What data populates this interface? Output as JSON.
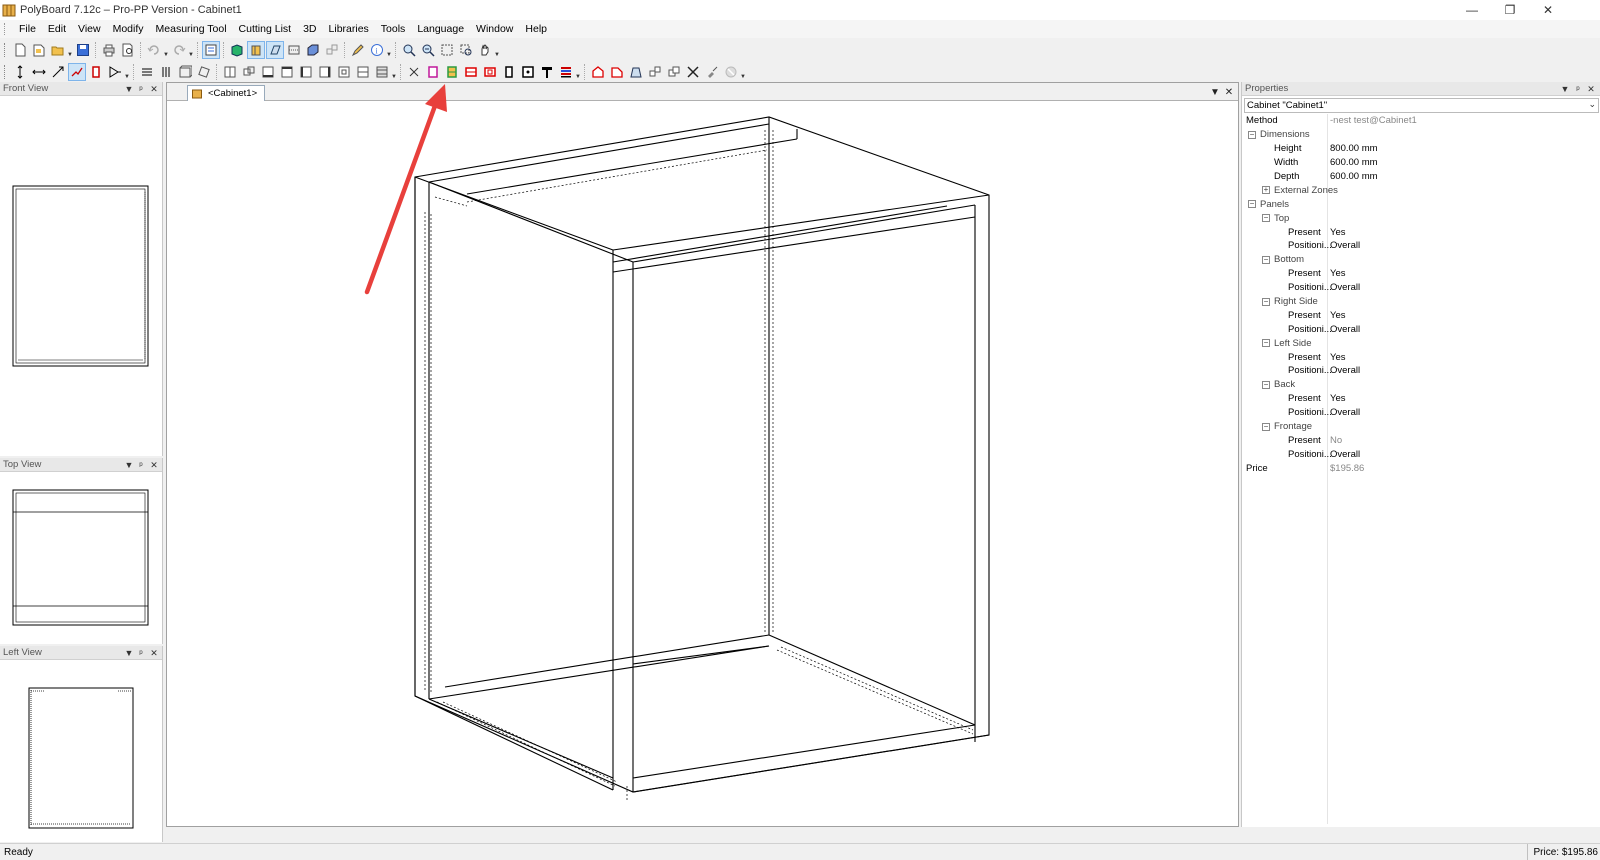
{
  "window": {
    "title": "PolyBoard 7.12c – Pro-PP Version - Cabinet1"
  },
  "menu": [
    "File",
    "Edit",
    "View",
    "Modify",
    "Measuring Tool",
    "Cutting List",
    "3D",
    "Libraries",
    "Tools",
    "Language",
    "Window",
    "Help"
  ],
  "panes": {
    "front": "Front View",
    "top": "Top View",
    "left": "Left View"
  },
  "document": {
    "tab_label": "<Cabinet1>"
  },
  "properties": {
    "title": "Properties",
    "object": "Cabinet \"Cabinet1\"",
    "rows": [
      {
        "name": "Method",
        "value": "-nest test@Cabinet1",
        "level": 0,
        "type": "prop",
        "muted": true
      },
      {
        "name": "Dimensions",
        "value": "",
        "level": 0,
        "type": "cat",
        "toggle": "−"
      },
      {
        "name": "Height",
        "value": "800.00 mm",
        "level": 1,
        "type": "prop"
      },
      {
        "name": "Width",
        "value": "600.00 mm",
        "level": 1,
        "type": "prop"
      },
      {
        "name": "Depth",
        "value": "600.00 mm",
        "level": 1,
        "type": "prop"
      },
      {
        "name": "External Zones",
        "value": "",
        "level": 1,
        "type": "cat",
        "toggle": "+"
      },
      {
        "name": "Panels",
        "value": "",
        "level": 0,
        "type": "cat",
        "toggle": "−"
      },
      {
        "name": "Top",
        "value": "",
        "level": 1,
        "type": "cat",
        "toggle": "−"
      },
      {
        "name": "Present",
        "value": "Yes",
        "level": 2,
        "type": "prop"
      },
      {
        "name": "Positioni...",
        "value": "Overall",
        "level": 2,
        "type": "prop"
      },
      {
        "name": "Bottom",
        "value": "",
        "level": 1,
        "type": "cat",
        "toggle": "−"
      },
      {
        "name": "Present",
        "value": "Yes",
        "level": 2,
        "type": "prop"
      },
      {
        "name": "Positioni...",
        "value": "Overall",
        "level": 2,
        "type": "prop"
      },
      {
        "name": "Right Side",
        "value": "",
        "level": 1,
        "type": "cat",
        "toggle": "−"
      },
      {
        "name": "Present",
        "value": "Yes",
        "level": 2,
        "type": "prop"
      },
      {
        "name": "Positioni...",
        "value": "Overall",
        "level": 2,
        "type": "prop"
      },
      {
        "name": "Left Side",
        "value": "",
        "level": 1,
        "type": "cat",
        "toggle": "−"
      },
      {
        "name": "Present",
        "value": "Yes",
        "level": 2,
        "type": "prop"
      },
      {
        "name": "Positioni...",
        "value": "Overall",
        "level": 2,
        "type": "prop"
      },
      {
        "name": "Back",
        "value": "",
        "level": 1,
        "type": "cat",
        "toggle": "−"
      },
      {
        "name": "Present",
        "value": "Yes",
        "level": 2,
        "type": "prop"
      },
      {
        "name": "Positioni...",
        "value": "Overall",
        "level": 2,
        "type": "prop"
      },
      {
        "name": "Frontage",
        "value": "",
        "level": 1,
        "type": "cat",
        "toggle": "−"
      },
      {
        "name": "Present",
        "value": "No",
        "level": 2,
        "type": "prop",
        "muted": true
      },
      {
        "name": "Positioni...",
        "value": "Overall",
        "level": 2,
        "type": "prop"
      },
      {
        "name": "Price",
        "value": "$195.86",
        "level": 0,
        "type": "prop",
        "muted": true
      }
    ]
  },
  "status": {
    "left": "Ready",
    "right": "Price: $195.86"
  },
  "colors": {
    "accent_arrow": "#e8403c",
    "toolbar_bg": "#f0f0f0",
    "pane_header": "#e8e8e8"
  }
}
